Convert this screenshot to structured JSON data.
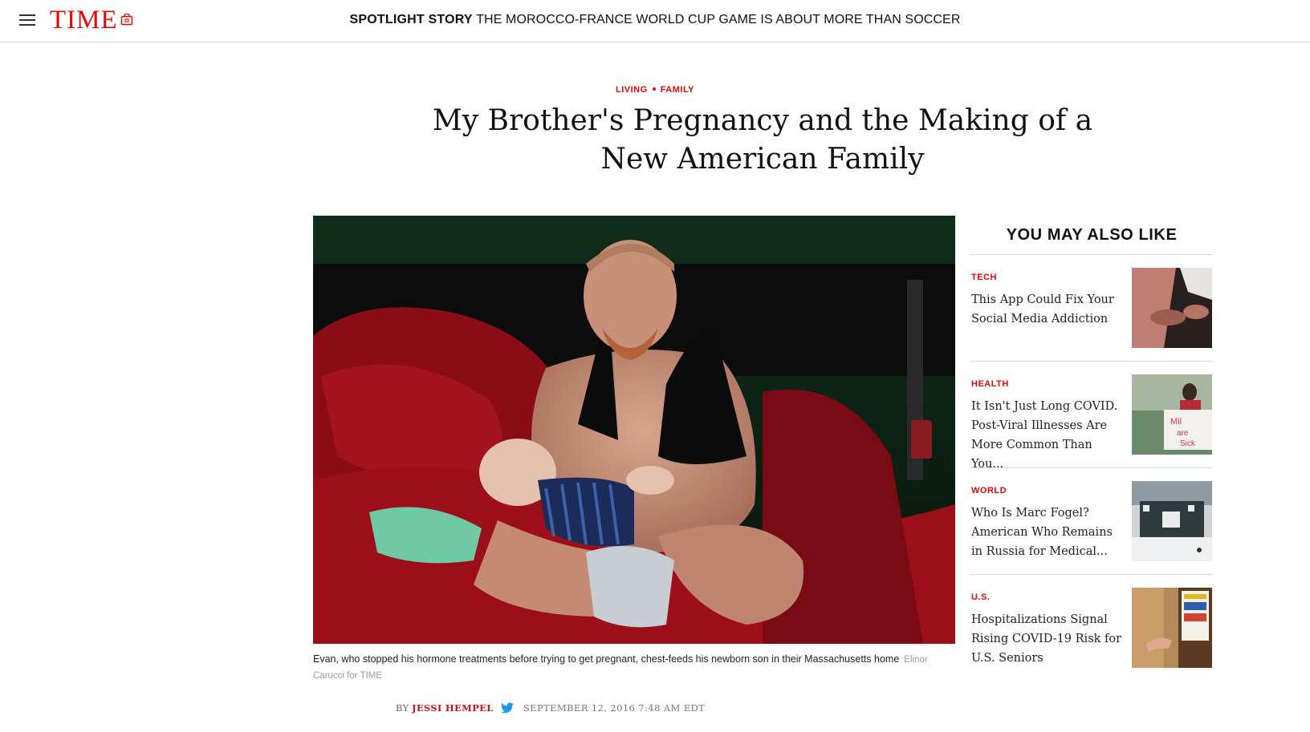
{
  "header": {
    "logo": "TIME",
    "menu_icon": "hamburger-menu-icon",
    "store_icon": "shop-bag-icon",
    "spotlight_lead": "SPOTLIGHT STORY",
    "spotlight_text": "THE MOROCCO-FRANCE WORLD CUP GAME IS ABOUT MORE THAN SOCCER"
  },
  "article": {
    "section": "LIVING",
    "subsection": "FAMILY",
    "headline_line1": "My Brother's Pregnancy and the Making of a",
    "headline_line2": "New American Family",
    "photo_icon": "hero-photo",
    "caption": "Evan, who stopped his hormone treatments before trying to get pregnant, chest-feeds his newborn son in their Massachusetts home",
    "credit": "Elinor Carucci for TIME",
    "byline_prefix": "BY",
    "author": "JESSI HEMPEL",
    "date": "SEPTEMBER 12, 2016 7:48 AM EDT"
  },
  "sidebar": {
    "title": "YOU MAY ALSO LIKE",
    "items": [
      {
        "category": "TECH",
        "title": "This App Could Fix Your Social Media Addiction"
      },
      {
        "category": "HEALTH",
        "title": "It Isn't Just Long COVID. Post-Viral Illnesses Are More Common Than You..."
      },
      {
        "category": "WORLD",
        "title": "Who Is Marc Fogel? American Who Remains in Russia for Medical..."
      },
      {
        "category": "U.S.",
        "title": "Hospitalizations Signal Rising COVID-19 Risk for U.S. Seniors"
      }
    ]
  },
  "colors": {
    "brand_red": "#e90606",
    "author_red": "#c4131f"
  }
}
